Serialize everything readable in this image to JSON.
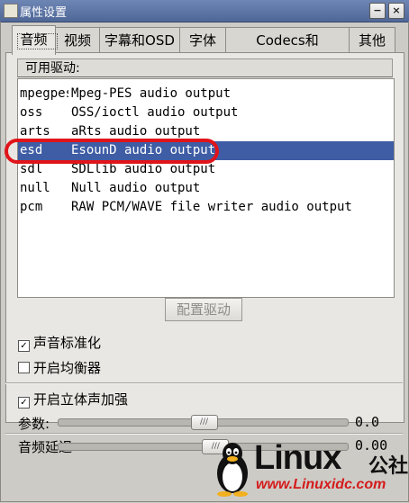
{
  "window": {
    "title": "属性设置",
    "minimize_glyph": "−",
    "close_glyph": "×"
  },
  "tabs": [
    {
      "label": "音频",
      "active": true
    },
    {
      "label": "视频"
    },
    {
      "label": "字幕和OSD"
    },
    {
      "label": "字体"
    },
    {
      "label": "Codecs和demuxer"
    },
    {
      "label": "其他"
    }
  ],
  "drivers": {
    "header": "可用驱动:",
    "rows": [
      {
        "name": "mpegpes",
        "desc": "Mpeg-PES audio output"
      },
      {
        "name": "oss",
        "desc": "OSS/ioctl audio output"
      },
      {
        "name": "arts",
        "desc": "aRts audio output"
      },
      {
        "name": "esd",
        "desc": "EsounD audio output",
        "selected": true
      },
      {
        "name": "sdl",
        "desc": "SDLlib audio output"
      },
      {
        "name": "null",
        "desc": "Null audio output"
      },
      {
        "name": "pcm",
        "desc": "RAW PCM/WAVE file writer audio output"
      }
    ],
    "config_button": "配置驱动"
  },
  "options": {
    "normalize": {
      "label": "声音标准化",
      "checked": true
    },
    "equalizer": {
      "label": "开启均衡器",
      "checked": false
    },
    "surround": {
      "label": "开启立体声加强",
      "checked": true
    }
  },
  "sliders": {
    "param": {
      "label": "参数:",
      "value": "0.0",
      "fraction": 0.5
    },
    "delay": {
      "label": "音频延迟",
      "value": "0.00",
      "fraction": 0.54
    }
  },
  "watermark": {
    "brand": "Linux",
    "brand_suffix": "公社",
    "url": "www.Linuxidc.com"
  },
  "colors": {
    "titlebar": "#5a72a4",
    "selection": "#3f5da5",
    "annotation_circle": "#e0141a"
  }
}
